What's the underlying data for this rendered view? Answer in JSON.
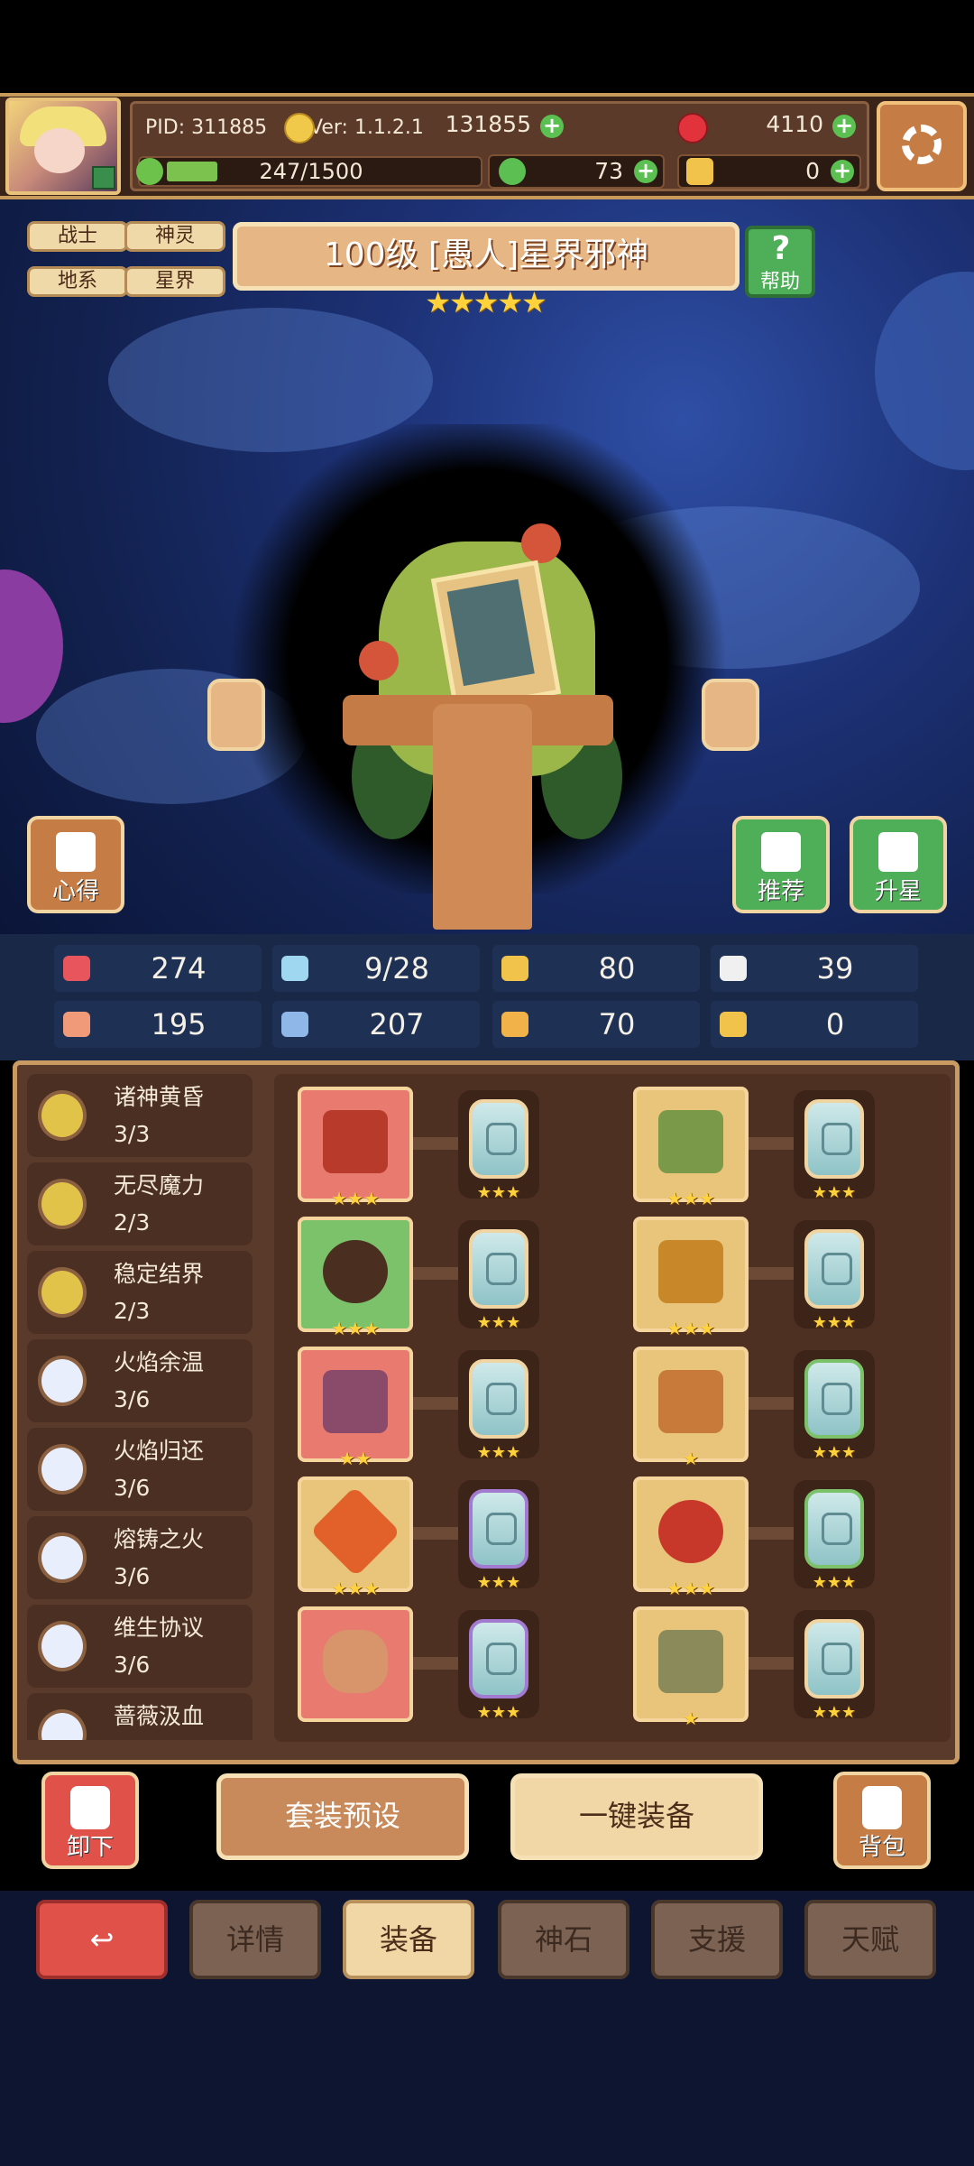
{
  "header": {
    "pid": "PID: 311885",
    "version": "Ver: 1.1.2.1",
    "exp": "247/1500",
    "exp_fraction": 0.165,
    "gold": "131855",
    "ruby": "4110",
    "clover": "73",
    "key": "0"
  },
  "tags": [
    "战士",
    "神灵",
    "地系",
    "星界"
  ],
  "hero": {
    "title": "100级 [愚人]星界邪神",
    "stars": "★★★★★",
    "help_label": "帮助"
  },
  "scene_buttons": {
    "insight": "心得",
    "recommend": "推荐",
    "star_up": "升星"
  },
  "stats": [
    {
      "icon": "heart-icon",
      "value": "274",
      "color": "#e8555c"
    },
    {
      "icon": "water-drop-icon",
      "value": "9/28",
      "color": "#9fd7f0"
    },
    {
      "icon": "shield-icon",
      "value": "80",
      "color": "#f2c34a"
    },
    {
      "icon": "wing-icon",
      "value": "39",
      "color": "#f0f0f0"
    },
    {
      "icon": "fist-icon",
      "value": "195",
      "color": "#f09a7a"
    },
    {
      "icon": "book-icon",
      "value": "207",
      "color": "#8fb8e8"
    },
    {
      "icon": "scroll-icon",
      "value": "70",
      "color": "#f2b24a"
    },
    {
      "icon": "horseshoe-icon",
      "value": "0",
      "color": "#f2c34a"
    }
  ],
  "sets": [
    {
      "name": "诸神黄昏",
      "count": "3/3"
    },
    {
      "name": "无尽魔力",
      "count": "2/3"
    },
    {
      "name": "稳定结界",
      "count": "2/3"
    },
    {
      "name": "火焰余温",
      "count": "3/6"
    },
    {
      "name": "火焰归还",
      "count": "3/6"
    },
    {
      "name": "熔铸之火",
      "count": "3/6"
    },
    {
      "name": "维生协议",
      "count": "3/6"
    },
    {
      "name": "蔷薇汲血",
      "count": ""
    }
  ],
  "equipment": [
    {
      "item": "crossed-claws",
      "stars": "★★★",
      "rune_stars": "★★★"
    },
    {
      "item": "leaf-crown",
      "stars": "★★★",
      "rune_stars": "★★★"
    },
    {
      "item": "dark-orb",
      "stars": "★★★",
      "rune_stars": "★★★"
    },
    {
      "item": "golden-armor",
      "stars": "★★★",
      "rune_stars": "★★★"
    },
    {
      "item": "chain-vest",
      "stars": "★★",
      "rune_stars": "★★★"
    },
    {
      "item": "leather-glove",
      "stars": "★",
      "rune_stars": "★★★"
    },
    {
      "item": "fire-crystal",
      "stars": "★★★",
      "rune_stars": "★★★"
    },
    {
      "item": "red-ring",
      "stars": "★★★",
      "rune_stars": "★★★"
    },
    {
      "item": "bracelet",
      "stars": "",
      "rune_stars": "★★★"
    },
    {
      "item": "boots",
      "stars": "★",
      "rune_stars": "★★★"
    }
  ],
  "actions": {
    "unequip": "卸下",
    "set_preset": "套装预设",
    "auto_equip": "一键装备",
    "backpack": "背包"
  },
  "tabs": {
    "details": "详情",
    "equipment": "装备",
    "god_stone": "神石",
    "support": "支援",
    "talent": "天赋"
  }
}
